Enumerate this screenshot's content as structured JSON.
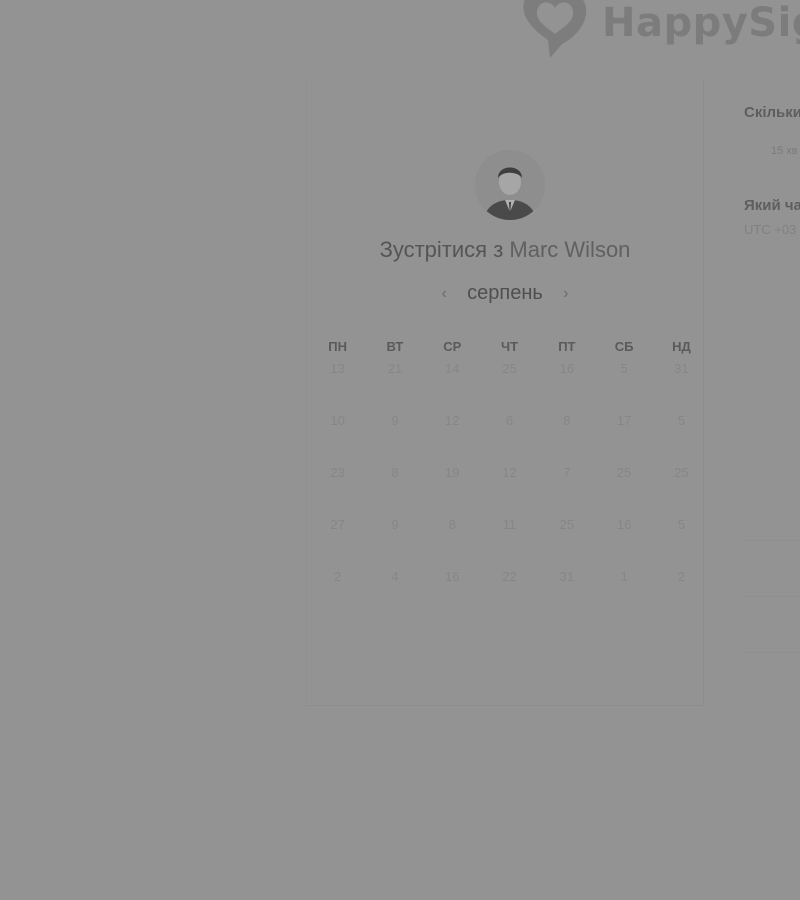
{
  "brand": {
    "name": "HappySig"
  },
  "calendar": {
    "title_prefix": "Зустрітися з",
    "host_name": "Marc Wilson",
    "month": "серпень",
    "prev_label": "‹",
    "next_label": "›",
    "weekdays": [
      "ПН",
      "ВТ",
      "СР",
      "ЧТ",
      "ПТ",
      "СБ",
      "НД"
    ],
    "weeks": [
      [
        "13",
        "21",
        "14",
        "25",
        "16",
        "5",
        "31"
      ],
      [
        "10",
        "9",
        "12",
        "6",
        "8",
        "17",
        "5"
      ],
      [
        "23",
        "8",
        "19",
        "12",
        "7",
        "25",
        "25"
      ],
      [
        "27",
        "9",
        "8",
        "11",
        "25",
        "16",
        "5"
      ],
      [
        "2",
        "4",
        "16",
        "22",
        "31",
        "1",
        "2"
      ]
    ]
  },
  "right_panel": {
    "duration_question": "Скільки",
    "duration_value": "15 хв",
    "time_question": "Який ча",
    "timezone": "UTC +03"
  },
  "colors": {
    "overlay": "#939393"
  }
}
